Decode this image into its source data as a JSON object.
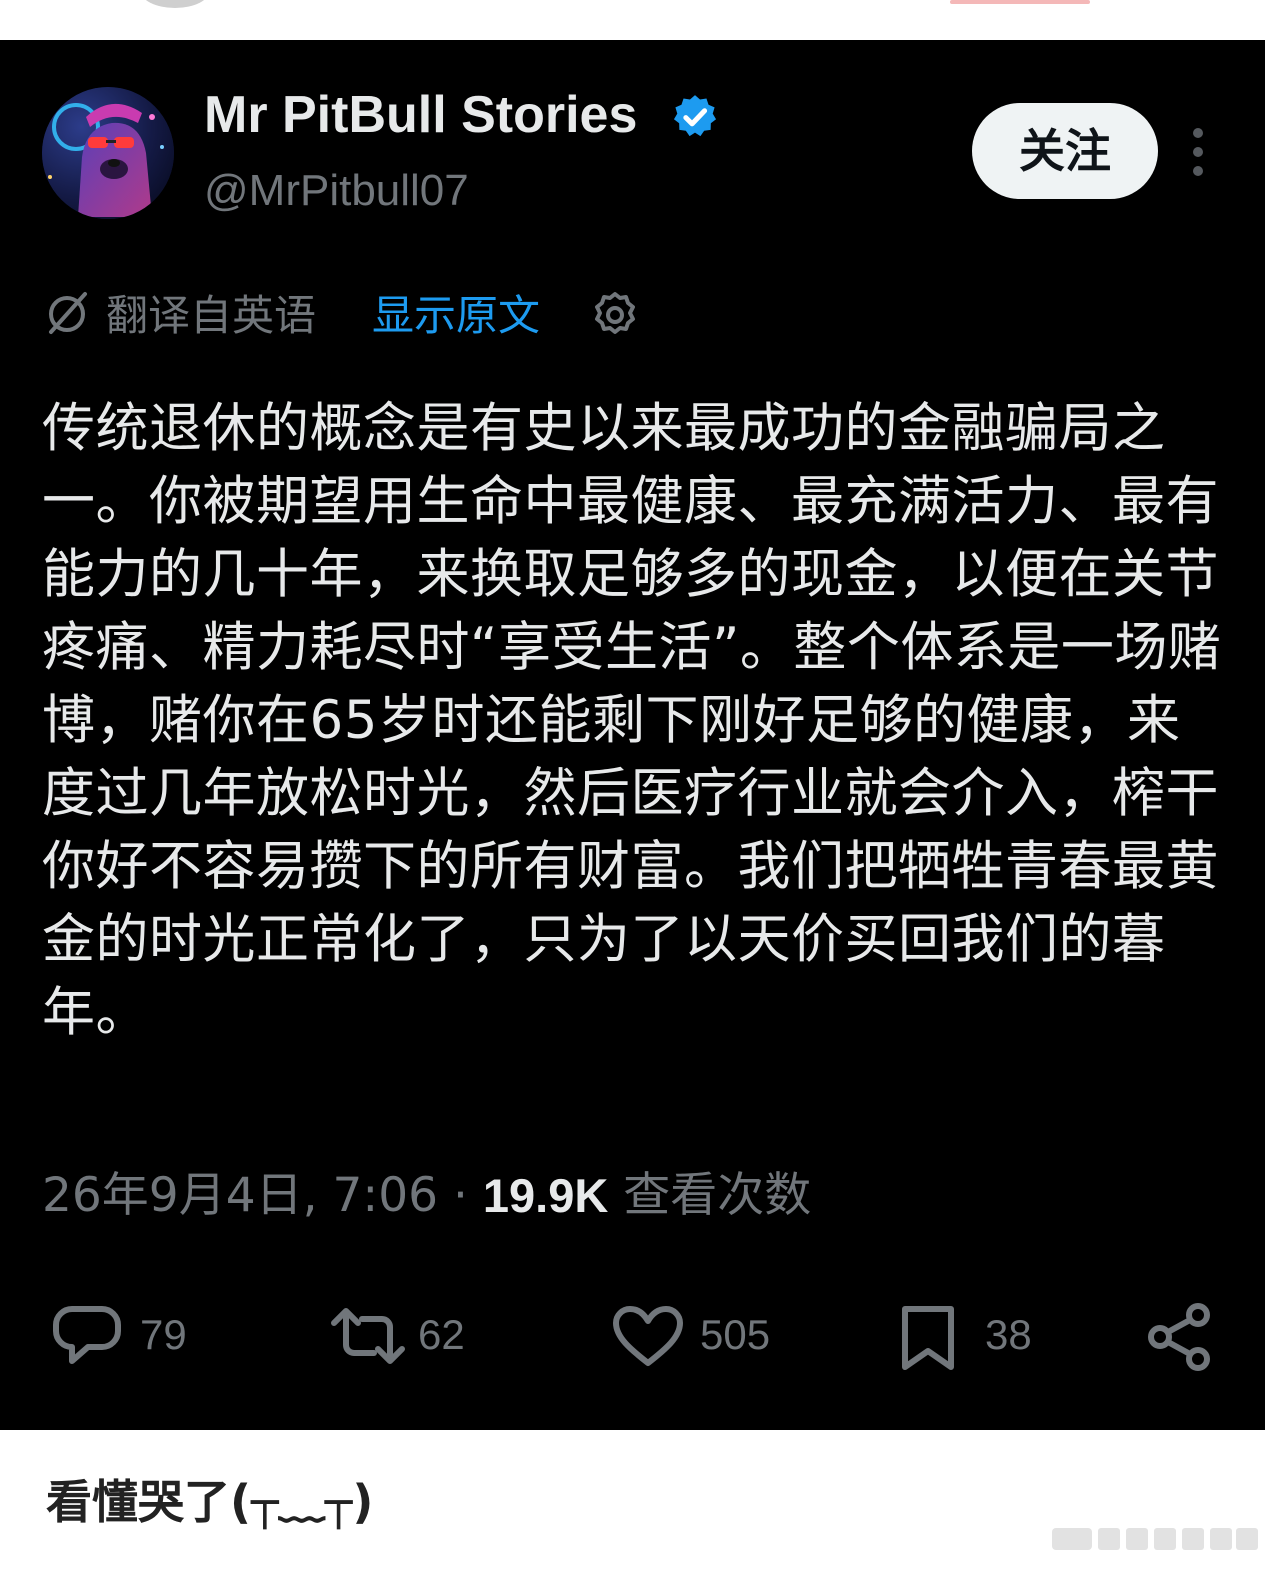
{
  "colors": {
    "background": "#000000",
    "text_primary": "#e7e9ea",
    "text_secondary": "#71767b",
    "link": "#1d9bf0",
    "verified": "#1d9bf0",
    "follow_button_bg": "#eff3f4",
    "follow_button_text": "#0f1419",
    "page_background": "#ffffff"
  },
  "author": {
    "display_name": "Mr PitBull Stories",
    "handle": "@MrPitbull07",
    "verified": true,
    "avatar_icon": "pitbull-with-sunglasses-avatar"
  },
  "follow_button_label": "关注",
  "translation": {
    "icon": "translate-icon",
    "label": "翻译自英语",
    "show_original_label": "显示原文",
    "settings_icon": "gear-icon"
  },
  "tweet_text": "传统退休的概念是有史以来最成功的金融骗局之一。你被期望用生命中最健康、最充满活力、最有能力的几十年，来换取足够多的现金，以便在关节疼痛、精力耗尽时“享受生活”。整个体系是一场赌博，赌你在65岁时还能剩下刚好足够的健康，来度过几年放松时光，然后医疗行业就会介入，榨干你好不容易攒下的所有财富。我们把牺牲青春最黄金的时光正常化了，只为了以天价买回我们的暮年。",
  "meta": {
    "timestamp": "26年9月4日, 7:06",
    "separator": "·",
    "view_count": "19.9K",
    "view_label": "查看次数"
  },
  "actions": {
    "reply_count": "79",
    "repost_count": "62",
    "like_count": "505",
    "bookmark_count": "38"
  },
  "comment": "看懂哭了(┬﹏┬)"
}
